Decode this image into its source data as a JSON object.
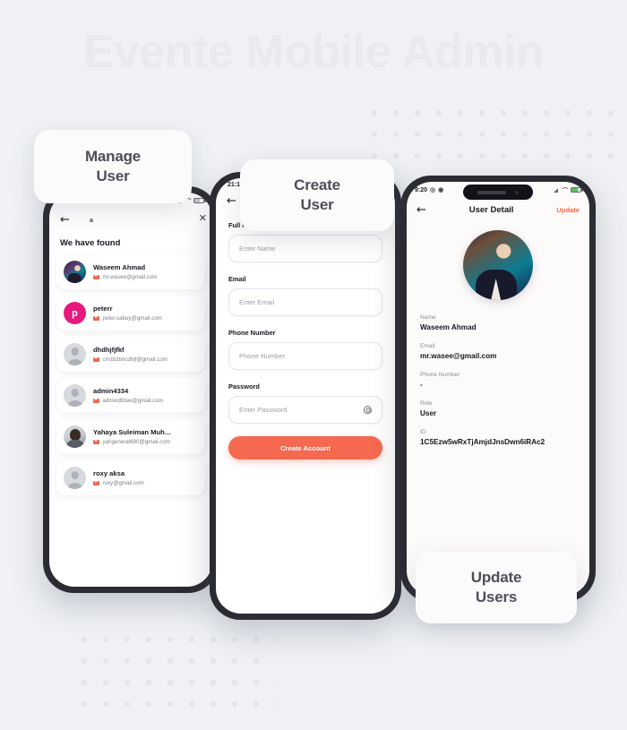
{
  "background": {
    "title": "Evente Mobile Admin",
    "accent_color": "#f4694f",
    "page_bg": "#eff1f4"
  },
  "labels": {
    "manage": "Manage\nUser",
    "manage_line1": "Manage",
    "manage_line2": "User",
    "create_line1": "Create",
    "create_line2": "User",
    "update_line1": "Update",
    "update_line2": "Users"
  },
  "phone_manage": {
    "statusbar": {
      "signal": "signal-icon",
      "wifi": "wifi-icon",
      "battery": "battery-icon"
    },
    "back_icon": "←",
    "close_icon": "✕",
    "search_value": "a",
    "heading": "We have found",
    "users": [
      {
        "name": "Waseem Ahmad",
        "email": "mr.wasee@gmail.com",
        "avatar": "photo"
      },
      {
        "name": "peterr",
        "email": "peter.sabuy@gmail.com",
        "avatar": "initial",
        "initial": "p",
        "avatar_color": "#e8197d"
      },
      {
        "name": "dhdhjfjfkf",
        "email": "cmzbzbncdhjf@gmail.com",
        "avatar": "placeholder"
      },
      {
        "name": "admin4334",
        "email": "admindfdsw@gmail.com",
        "avatar": "placeholder"
      },
      {
        "name": "Yahaya Suleiman Muh…",
        "email": "yahgeneral690@gmail.com",
        "avatar": "photo2"
      },
      {
        "name": "roxy aksa",
        "email": "roxy@gmail.com",
        "avatar": "placeholder"
      }
    ]
  },
  "phone_create": {
    "time": "21:17",
    "back_icon": "←",
    "title": "Create User",
    "fields": [
      {
        "label": "Full Name",
        "placeholder": "Enter Name",
        "value": ""
      },
      {
        "label": "Email",
        "placeholder": "Enter Email",
        "value": ""
      },
      {
        "label": "Phone Number",
        "placeholder": "Phone Number",
        "value": ""
      },
      {
        "label": "Password",
        "placeholder": "Enter Password",
        "value": "",
        "trailing_icon": "eye-icon"
      }
    ],
    "submit_label": "Create Account"
  },
  "phone_detail": {
    "statusbar": {
      "time": "9:20",
      "alarm": "alarm-icon",
      "extra": "dot-icon",
      "signal": "signal-icon",
      "wifi": "wifi-icon",
      "battery": "battery-icon"
    },
    "back_icon": "←",
    "title": "User Detail",
    "update_label": "Update",
    "avatar": "photo",
    "fields": [
      {
        "label": "Name",
        "value": "Waseem Ahmad"
      },
      {
        "label": "Email",
        "value": "mr.wasee@gmail.com"
      },
      {
        "label": "Phone Number",
        "value": "-"
      },
      {
        "label": "Role",
        "value": "User"
      },
      {
        "label": "ID",
        "value": "1C5Ezw5wRxTjAmjdJnsDwn6iRAc2"
      }
    ]
  }
}
